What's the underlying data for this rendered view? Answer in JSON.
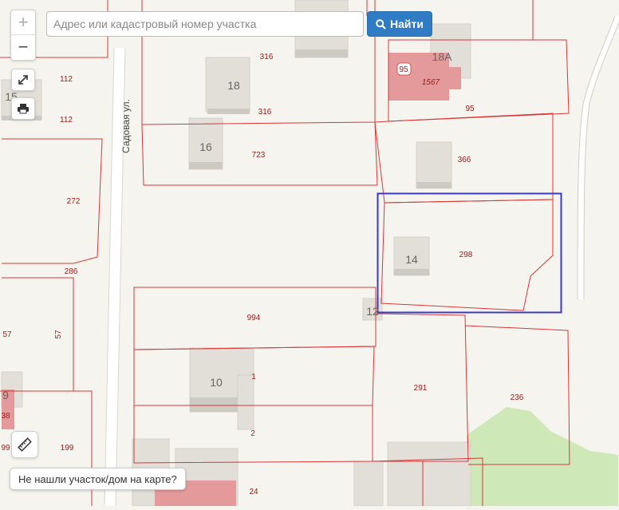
{
  "search": {
    "placeholder": "Адрес или кадастровый номер участка",
    "button_label": "Найти"
  },
  "zoom": {
    "in_label": "+",
    "out_label": "−"
  },
  "street_label": "Садовая ул.",
  "not_found_label": "Не нашли участок/дом на карте?",
  "house_numbers": [
    "15",
    "18",
    "18А",
    "16",
    "14",
    "12",
    "10",
    "9",
    "38"
  ],
  "parcel_labels": [
    "316",
    "316",
    "112",
    "112",
    "95",
    "1567",
    "95",
    "723",
    "366",
    "272",
    "298",
    "286",
    "994",
    "57",
    "57",
    "1",
    "291",
    "236",
    "2",
    "199",
    "99",
    "24"
  ],
  "colors": {
    "parcel_border": "#d63838",
    "parcel_label": "#a01c1c",
    "highlight": "#3a3ac4",
    "building": "#e2ded8",
    "cadastral_fill": "#e49a9a",
    "green_area": "#cfe8b8",
    "background": "#f6f4ef"
  }
}
